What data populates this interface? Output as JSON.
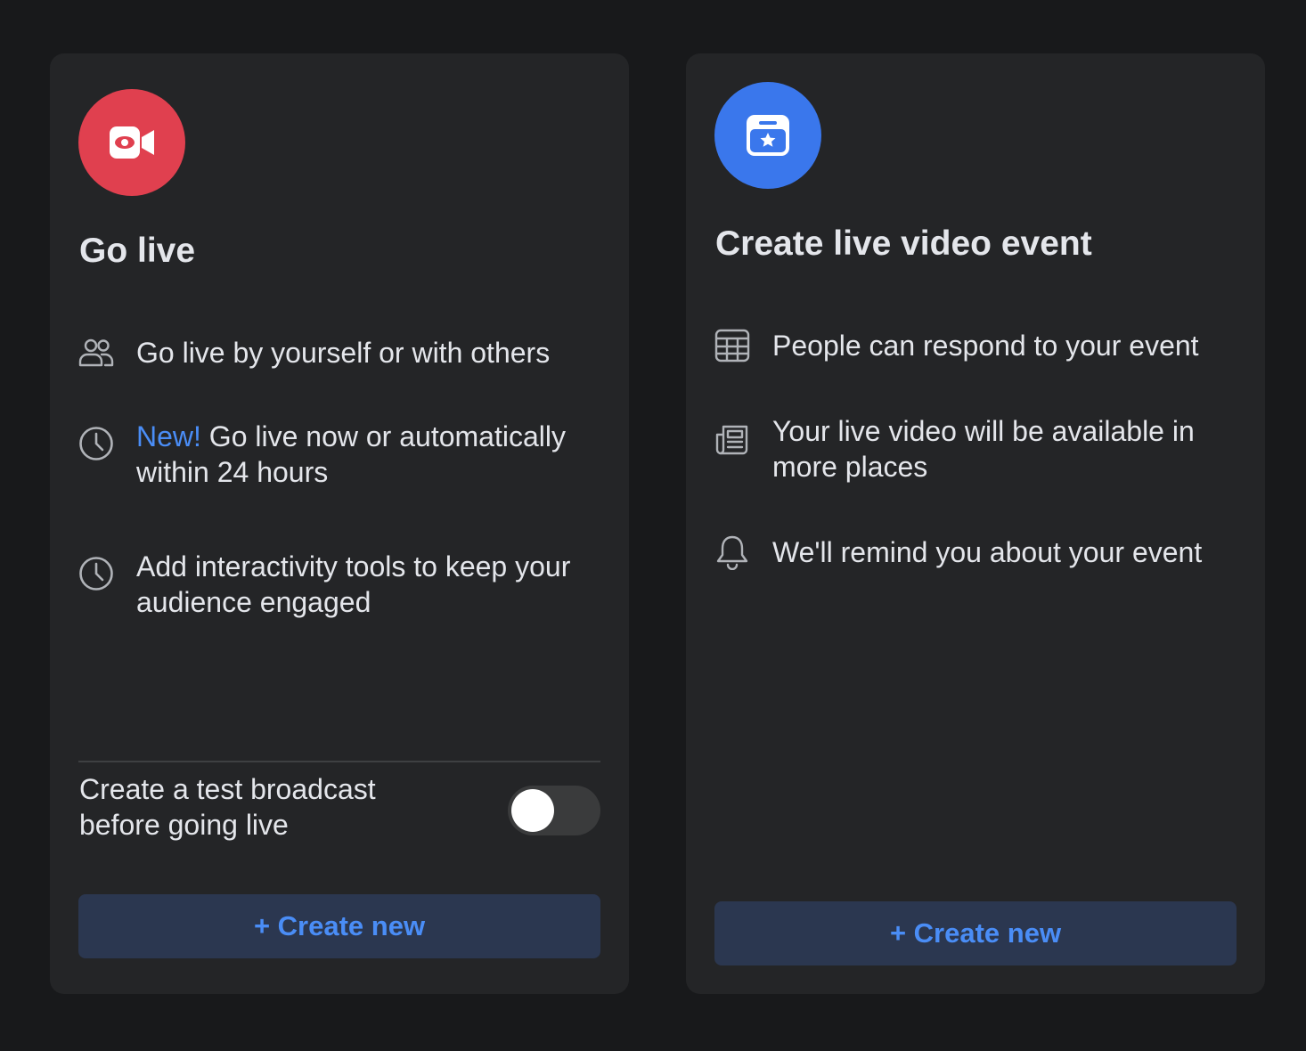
{
  "colors": {
    "page_background": "#18191b",
    "card_background": "#242527",
    "go_live_accent": "#e0404f",
    "event_accent": "#3a77ec",
    "link_blue": "#4a8df6",
    "button_background": "#2b3750"
  },
  "go_live_card": {
    "icon": "video-camera-eye-icon",
    "title": "Go live",
    "features": [
      {
        "icon": "people-icon",
        "text": "Go live by yourself or with others"
      },
      {
        "icon": "clock-icon",
        "tag": "New!",
        "text": "Go live now or automatically within 24 hours"
      },
      {
        "icon": "clock-icon",
        "text": "Add interactivity tools to keep your audience engaged"
      }
    ],
    "test_broadcast": {
      "label": "Create a test broadcast before going live",
      "enabled": false
    },
    "create_button": "+ Create new"
  },
  "event_card": {
    "icon": "calendar-star-icon",
    "title": "Create live video event",
    "features": [
      {
        "icon": "calendar-grid-icon",
        "text": "People can respond to your event"
      },
      {
        "icon": "newspaper-icon",
        "text": "Your live video will be available in more places"
      },
      {
        "icon": "bell-icon",
        "text": "We'll remind you about your event"
      }
    ],
    "create_button": "+ Create new"
  }
}
